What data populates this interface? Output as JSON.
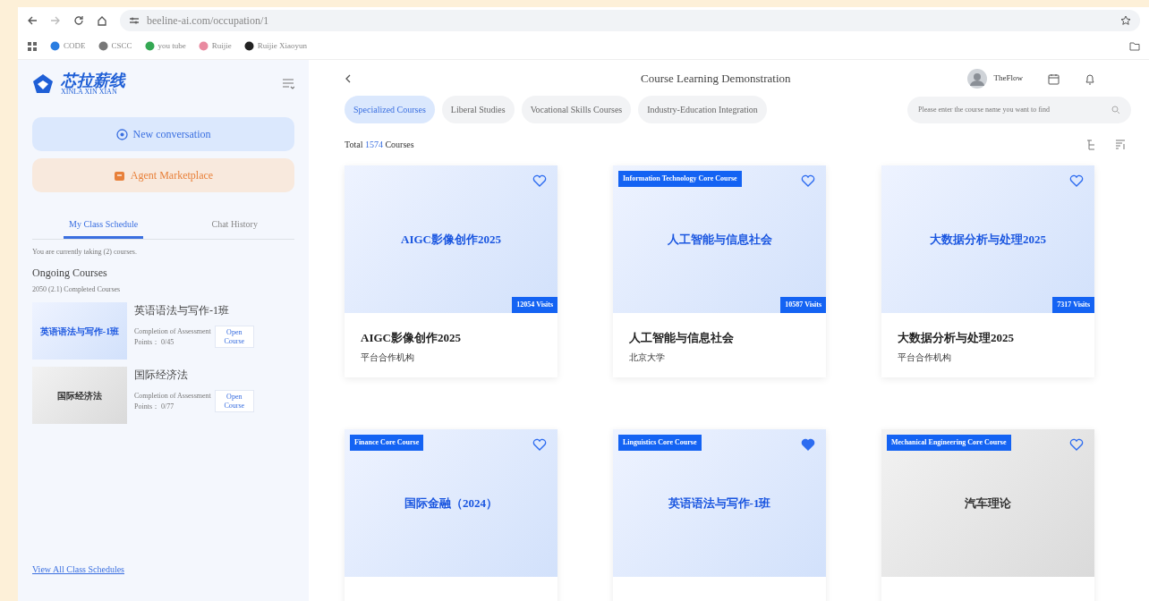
{
  "browser": {
    "url": "beeline-ai.com/occupation/1",
    "bookmarks": [
      {
        "label": "CODE"
      },
      {
        "label": "CSCC"
      },
      {
        "label": "you tube"
      },
      {
        "label": "Ruijie"
      },
      {
        "label": "Ruijie Xiaoyun"
      }
    ]
  },
  "sidebar": {
    "logo_title": "芯拉薪线",
    "logo_subtitle": "XINLA XIN XIAN",
    "new_conversation": "New conversation",
    "agent_marketplace": "Agent Marketplace",
    "tabs": [
      {
        "label": "My Class Schedule",
        "selected": true
      },
      {
        "label": "Chat History",
        "selected": false
      }
    ],
    "taking_text": "You are currently taking (2) courses.",
    "ongoing_heading": "Ongoing Courses",
    "completed_text": "2050 (2.1) Completed Courses",
    "courses": [
      {
        "title": "英语语法与写作-1班",
        "thumb_text": "英语语法与写作-1班",
        "kind": "blue",
        "assessment": "Completion of Assessment",
        "points": "Points： 0/45",
        "open_label": "Open Course"
      },
      {
        "title": "国际经济法",
        "thumb_text": "国际经济法",
        "kind": "grey",
        "assessment": "Completion of Assessment",
        "points": "Points： 0/77",
        "open_label": "Open Course"
      }
    ],
    "view_all": "View All Class Schedules"
  },
  "header": {
    "title": "Course Learning Demonstration",
    "user_name": "TheFlow"
  },
  "categories": [
    {
      "label": "Specialized Courses",
      "selected": true
    },
    {
      "label": "Liberal Studies",
      "selected": false
    },
    {
      "label": "Vocational Skills Courses",
      "selected": false
    },
    {
      "label": "Industry-Education Integration",
      "selected": false
    }
  ],
  "search": {
    "placeholder": "Please enter the course name you want to find"
  },
  "total": {
    "prefix": "Total",
    "count": "1574",
    "suffix": "Courses"
  },
  "courses": [
    {
      "cover_title": "AIGC影像创作2025",
      "visits": "12054 Visits",
      "name": "AIGC影像创作2025",
      "org": "平台合作机构",
      "favorited": false,
      "kind": "blue"
    },
    {
      "tag": "Information Technology Core Course",
      "cover_title": "人工智能与信息社会",
      "visits": "10587 Visits",
      "name": "人工智能与信息社会",
      "org": "北京大学",
      "favorited": false,
      "kind": "blue"
    },
    {
      "cover_title": "大数据分析与处理2025",
      "visits": "7317 Visits",
      "name": "大数据分析与处理2025",
      "org": "平台合作机构",
      "favorited": false,
      "kind": "blue"
    },
    {
      "tag": "Finance Core Course",
      "cover_title": "国际金融（2024）",
      "favorited": false,
      "kind": "blue"
    },
    {
      "tag": "Linguistics Core Course",
      "cover_title": "英语语法与写作-1班",
      "favorited": true,
      "kind": "blue"
    },
    {
      "tag": "Mechanical Engineering Core Course",
      "cover_title": "汽车理论",
      "favorited": false,
      "kind": "grey"
    }
  ]
}
